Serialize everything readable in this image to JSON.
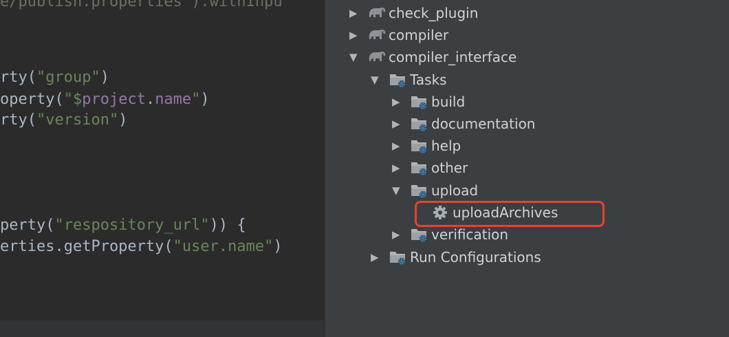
{
  "editor": {
    "lines": [
      {
        "parts": [
          {
            "t": "e/publish.properties\").withInpu",
            "c": "dim"
          }
        ]
      },
      {
        "parts": [
          {
            "t": "rty(",
            "c": "plain"
          },
          {
            "t": "\"group\"",
            "c": "str"
          },
          {
            "t": ")",
            "c": "plain"
          }
        ]
      },
      {
        "parts": [
          {
            "t": "operty(",
            "c": "plain"
          },
          {
            "t": "\"$",
            "c": "str"
          },
          {
            "t": "project",
            "c": "prop"
          },
          {
            "t": ".",
            "c": "plain"
          },
          {
            "t": "name",
            "c": "prop"
          },
          {
            "t": "\"",
            "c": "str"
          },
          {
            "t": ")",
            "c": "plain"
          }
        ]
      },
      {
        "parts": [
          {
            "t": "rty(",
            "c": "plain"
          },
          {
            "t": "\"version\"",
            "c": "str"
          },
          {
            "t": ")",
            "c": "plain"
          }
        ]
      },
      {
        "parts": [
          {
            "t": "perty(",
            "c": "plain"
          },
          {
            "t": "\"respository_url\"",
            "c": "str"
          },
          {
            "t": ")) {",
            "c": "plain"
          }
        ]
      },
      {
        "parts": [
          {
            "t": "erties.getProperty(",
            "c": "plain"
          },
          {
            "t": "\"user.name\"",
            "c": "str"
          },
          {
            "t": ")",
            "c": "plain"
          }
        ]
      }
    ]
  },
  "tree": {
    "nodes": [
      {
        "label": "check_plugin",
        "expanded": false,
        "icon": "gradle-elephant-icon"
      },
      {
        "label": "compiler",
        "expanded": false,
        "icon": "gradle-elephant-icon"
      },
      {
        "label": "compiler_interface",
        "expanded": true,
        "icon": "gradle-elephant-icon"
      },
      {
        "label": "Tasks",
        "expanded": true,
        "icon": "folder-gear-icon"
      },
      {
        "label": "build",
        "expanded": false,
        "icon": "folder-gear-icon"
      },
      {
        "label": "documentation",
        "expanded": false,
        "icon": "folder-gear-icon"
      },
      {
        "label": "help",
        "expanded": false,
        "icon": "folder-gear-icon"
      },
      {
        "label": "other",
        "expanded": false,
        "icon": "folder-gear-icon"
      },
      {
        "label": "upload",
        "expanded": true,
        "icon": "folder-gear-icon"
      },
      {
        "label": "uploadArchives",
        "expanded": null,
        "icon": "gear-icon"
      },
      {
        "label": "verification",
        "expanded": false,
        "icon": "folder-gear-icon"
      },
      {
        "label": "Run Configurations",
        "expanded": false,
        "icon": "folder-gear-icon"
      }
    ]
  },
  "colors": {
    "editor_bg": "#2b2b2b",
    "tree_bg": "#3c3f41",
    "string": "#6a8759",
    "property": "#9876aa",
    "highlight": "#e8432a"
  }
}
